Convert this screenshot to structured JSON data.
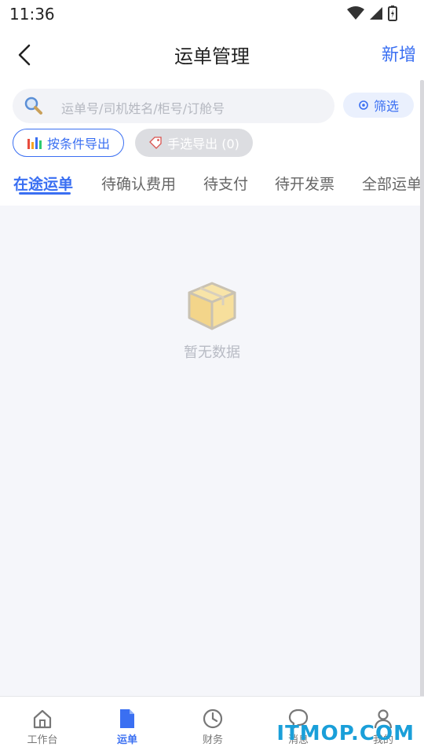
{
  "status": {
    "time": "11:36"
  },
  "header": {
    "title": "运单管理",
    "add_label": "新增"
  },
  "search": {
    "placeholder": "运单号/司机姓名/柜号/订舱号"
  },
  "filter": {
    "label": "筛选"
  },
  "export": {
    "condition_label": "按条件导出",
    "manual_label": "手选导出 (0)"
  },
  "tabs": [
    {
      "label": "在途运单"
    },
    {
      "label": "待确认费用"
    },
    {
      "label": "待支付"
    },
    {
      "label": "待开发票"
    },
    {
      "label": "全部运单"
    }
  ],
  "empty": {
    "text": "暂无数据"
  },
  "tabbar": [
    {
      "label": "工作台",
      "icon": "home-icon"
    },
    {
      "label": "运单",
      "icon": "document-icon"
    },
    {
      "label": "财务",
      "icon": "clock-icon"
    },
    {
      "label": "消息",
      "icon": "chat-icon"
    },
    {
      "label": "我的",
      "icon": "user-icon"
    }
  ],
  "watermark": "ITMOP.COM",
  "colors": {
    "accent": "#3a6ff2",
    "box": "#f5d98f"
  }
}
